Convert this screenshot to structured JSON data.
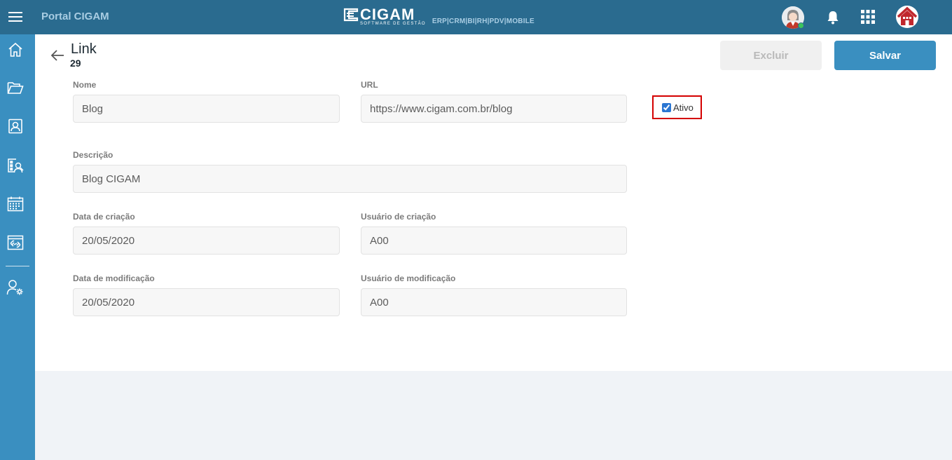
{
  "header": {
    "portal_title": "Portal CIGAM",
    "brand_name": "CIGAM",
    "brand_tagline": "SOFTWARE DE GESTÃO",
    "brand_modules": "ERP|CRM|BI|RH|PDV|MOBILE"
  },
  "sidebar": {
    "items": [
      {
        "icon": "home-icon"
      },
      {
        "icon": "folder-icon"
      },
      {
        "icon": "contacts-icon"
      },
      {
        "icon": "people-list-icon"
      },
      {
        "icon": "calendar-icon"
      },
      {
        "icon": "links-icon"
      },
      {
        "icon": "user-settings-icon"
      }
    ]
  },
  "page": {
    "title": "Link",
    "id": "29"
  },
  "actions": {
    "delete_label": "Excluir",
    "save_label": "Salvar"
  },
  "form": {
    "name_label": "Nome",
    "name_value": "Blog",
    "url_label": "URL",
    "url_value": "https://www.cigam.com.br/blog",
    "active_label": "Ativo",
    "active_checked": true,
    "description_label": "Descrição",
    "description_value": "Blog CIGAM",
    "created_date_label": "Data de criação",
    "created_date_value": "20/05/2020",
    "created_user_label": "Usuário de criação",
    "created_user_value": "A00",
    "modified_date_label": "Data de modificação",
    "modified_date_value": "20/05/2020",
    "modified_user_label": "Usuário de modificação",
    "modified_user_value": "A00"
  },
  "colors": {
    "topbar": "#2a6b8f",
    "sidebar": "#3a8fc0",
    "primary": "#3a8fc0",
    "highlight_border": "#d40000",
    "online": "#3cc45c"
  }
}
